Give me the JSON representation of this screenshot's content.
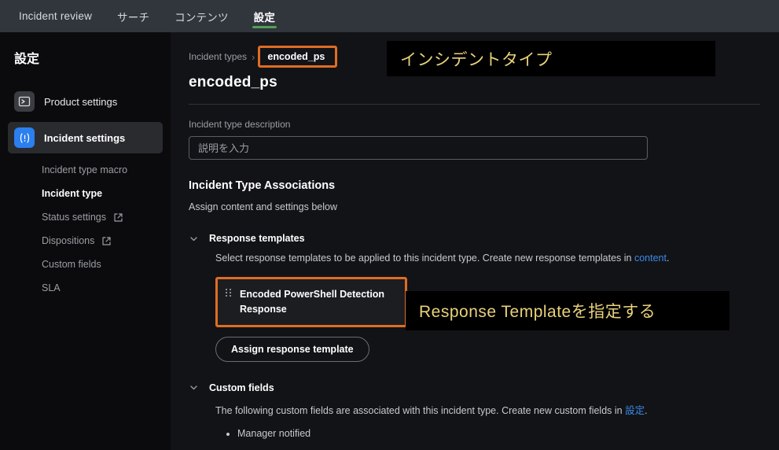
{
  "topnav": {
    "items": [
      {
        "label": "Incident review",
        "active": false
      },
      {
        "label": "サーチ",
        "active": false
      },
      {
        "label": "コンテンツ",
        "active": false
      },
      {
        "label": "設定",
        "active": true
      }
    ]
  },
  "sidebar": {
    "title": "設定",
    "items": [
      {
        "label": "Product settings",
        "icon": "terminal-icon",
        "active": false
      },
      {
        "label": "Incident settings",
        "icon": "alert-icon",
        "active": true
      }
    ],
    "subitems": [
      {
        "label": "Incident type macro",
        "external": false,
        "current": false
      },
      {
        "label": "Incident type",
        "external": false,
        "current": true
      },
      {
        "label": "Status settings",
        "external": true,
        "current": false
      },
      {
        "label": "Dispositions",
        "external": true,
        "current": false
      },
      {
        "label": "Custom fields",
        "external": false,
        "current": false
      },
      {
        "label": "SLA",
        "external": false,
        "current": false
      }
    ]
  },
  "main": {
    "breadcrumb": {
      "parent": "Incident types",
      "separator": "›",
      "current": "encoded_ps"
    },
    "page_title": "encoded_ps",
    "description": {
      "label": "Incident type description",
      "value": "",
      "placeholder": "説明を入力"
    },
    "associations": {
      "title": "Incident Type Associations",
      "subtitle": "Assign content and settings below"
    },
    "response_templates": {
      "heading": "Response templates",
      "description_before": "Select response templates to be applied to this incident type. Create new response templates in ",
      "link_text": "content",
      "description_after": ".",
      "template_card": "Encoded PowerShell Detection Response",
      "assign_button": "Assign response template"
    },
    "custom_fields": {
      "heading": "Custom fields",
      "description_before": "The following custom fields are associated with this incident type. Create new custom fields in ",
      "link_text": "設定",
      "description_after": ".",
      "items": [
        "Manager notified"
      ]
    }
  },
  "annotations": [
    {
      "text": "インシデントタイプ"
    },
    {
      "text": "Response Templateを指定する"
    }
  ],
  "colors": {
    "accent_green": "#53a051",
    "highlight_orange": "#e06c24",
    "link_blue": "#3a8ae8",
    "annotation_yellow": "#e8d27a",
    "icon_blue": "#2b7fef"
  }
}
